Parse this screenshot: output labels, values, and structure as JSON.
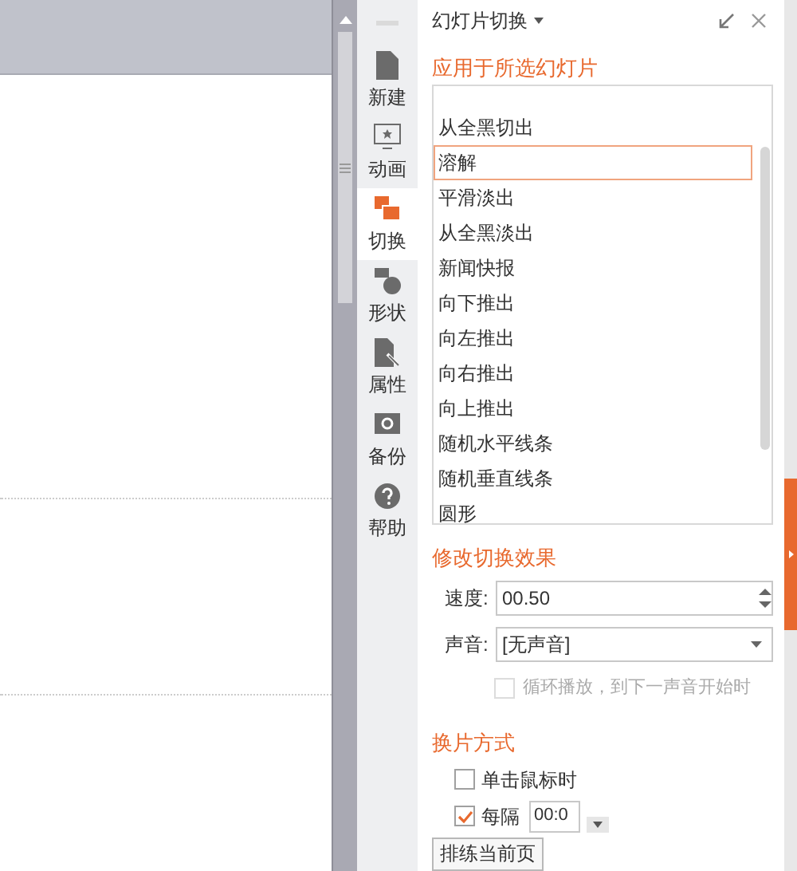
{
  "nav": [
    {
      "label": "新建",
      "kind": "file",
      "selected": false
    },
    {
      "label": "动画",
      "kind": "animation",
      "selected": false
    },
    {
      "label": "切换",
      "kind": "transition",
      "selected": true
    },
    {
      "label": "形状",
      "kind": "shape",
      "selected": false
    },
    {
      "label": "属性",
      "kind": "property",
      "selected": false
    },
    {
      "label": "备份",
      "kind": "backup",
      "selected": false
    },
    {
      "label": "帮助",
      "kind": "help",
      "selected": false
    }
  ],
  "panel": {
    "title": "幻灯片切换",
    "apply_heading": "应用于所选幻灯片",
    "effects": [
      {
        "label": "从全黑切出",
        "selected": false
      },
      {
        "label": "溶解",
        "selected": true
      },
      {
        "label": "平滑淡出",
        "selected": false
      },
      {
        "label": "从全黑淡出",
        "selected": false
      },
      {
        "label": "新闻快报",
        "selected": false
      },
      {
        "label": "向下推出",
        "selected": false
      },
      {
        "label": "向左推出",
        "selected": false
      },
      {
        "label": "向右推出",
        "selected": false
      },
      {
        "label": "向上推出",
        "selected": false
      },
      {
        "label": "随机水平线条",
        "selected": false
      },
      {
        "label": "随机垂直线条",
        "selected": false
      },
      {
        "label": "圆形",
        "selected": false
      }
    ],
    "modify_heading": "修改切换效果",
    "speed": {
      "label": "速度:",
      "value": "00.50"
    },
    "sound": {
      "label": "声音:",
      "value": "[无声音]"
    },
    "loop": {
      "label": "循环播放，到下一声音开始时",
      "checked": false,
      "disabled": true
    },
    "advance_heading": "换片方式",
    "on_click": {
      "label": "单击鼠标时",
      "checked": false
    },
    "every": {
      "label": "每隔",
      "checked": true,
      "value": "00:0"
    },
    "rehearse_button": "排练当前页"
  }
}
